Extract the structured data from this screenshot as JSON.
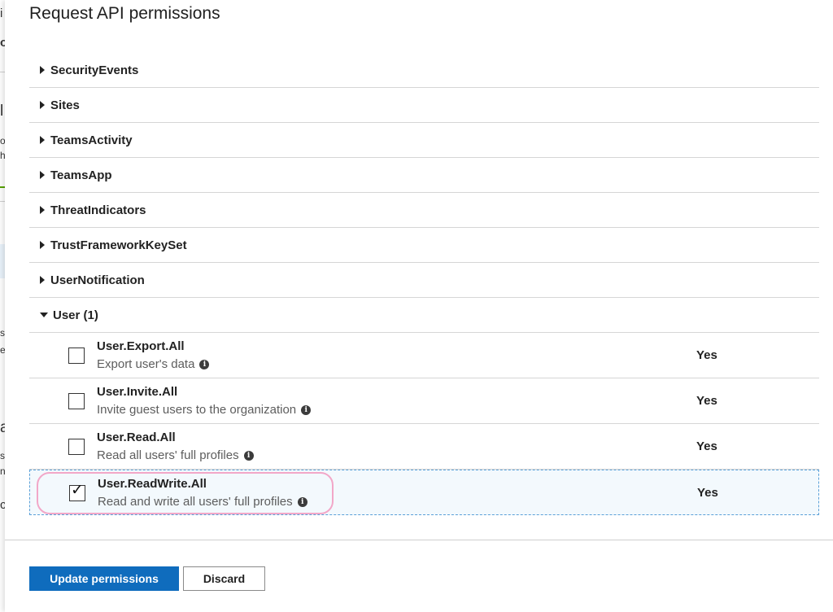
{
  "panel": {
    "title": "Request API permissions"
  },
  "background_fragments": [
    "i",
    "o",
    "l",
    "o",
    "h",
    "s",
    "e",
    "a",
    "s",
    "n",
    "c"
  ],
  "groups": [
    {
      "label": "SecurityEvents",
      "expanded": false
    },
    {
      "label": "Sites",
      "expanded": false
    },
    {
      "label": "TeamsActivity",
      "expanded": false
    },
    {
      "label": "TeamsApp",
      "expanded": false
    },
    {
      "label": "ThreatIndicators",
      "expanded": false
    },
    {
      "label": "TrustFrameworkKeySet",
      "expanded": false
    },
    {
      "label": "UserNotification",
      "expanded": false
    },
    {
      "label": "User (1)",
      "expanded": true
    }
  ],
  "permissions": [
    {
      "name": "User.Export.All",
      "description": "Export user's data",
      "admin_consent": "Yes",
      "checked": false
    },
    {
      "name": "User.Invite.All",
      "description": "Invite guest users to the organization",
      "admin_consent": "Yes",
      "checked": false
    },
    {
      "name": "User.Read.All",
      "description": "Read all users' full profiles",
      "admin_consent": "Yes",
      "checked": false
    },
    {
      "name": "User.ReadWrite.All",
      "description": "Read and write all users' full profiles",
      "admin_consent": "Yes",
      "checked": true
    }
  ],
  "footer": {
    "update_label": "Update permissions",
    "discard_label": "Discard"
  },
  "colors": {
    "primary": "#0f6cbd",
    "highlight": "#f2a7c8",
    "selected_row": "#f3f9fd"
  }
}
